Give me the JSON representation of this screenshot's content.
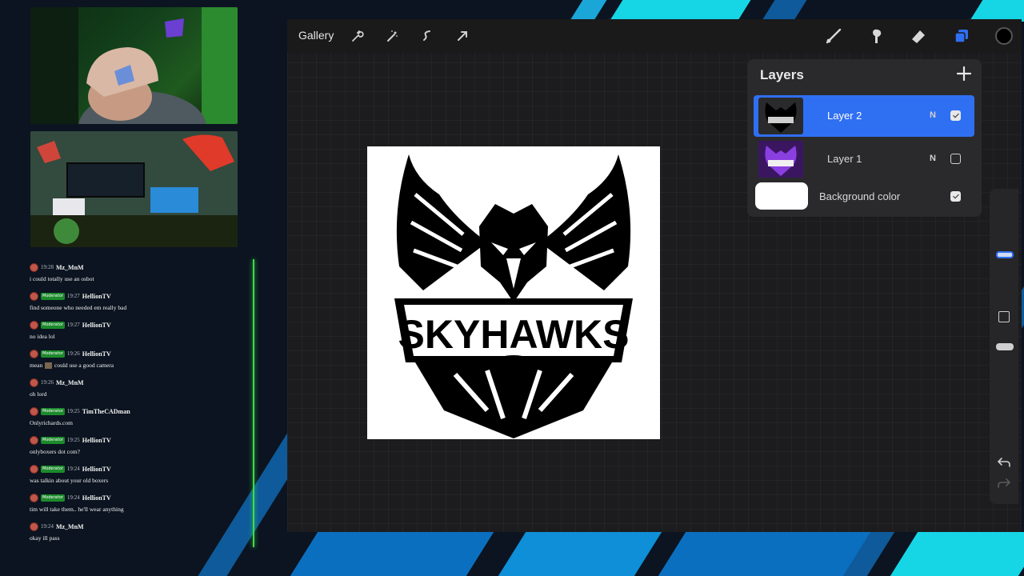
{
  "procreate": {
    "gallery_label": "Gallery",
    "tools_left": [
      "wrench-icon",
      "magic-wand-icon",
      "selection-icon",
      "transform-arrow-icon"
    ],
    "tools_right": [
      "brush-icon",
      "smudge-icon",
      "eraser-icon",
      "layers-icon",
      "color-swatch-icon"
    ],
    "accent_color": "#2f6ff2",
    "active_color": "#000000",
    "artwork_text": "SKYHAWKS",
    "layers_panel": {
      "title": "Layers",
      "layers": [
        {
          "name": "Layer 2",
          "mode": "N",
          "visible": true,
          "active": true
        },
        {
          "name": "Layer 1",
          "mode": "N",
          "visible": false,
          "active": false
        }
      ],
      "background": {
        "name": "Background color",
        "visible": true
      }
    }
  },
  "chat": {
    "accent_color": "#3ddc4a",
    "messages": [
      {
        "time": "19:28",
        "user": "Mz_MnM",
        "moderator": false,
        "text": "i could totally use an osbot"
      },
      {
        "time": "19:27",
        "user": "HellionTV",
        "moderator": true,
        "text": "find someone who needed em really bad"
      },
      {
        "time": "19:27",
        "user": "HellionTV",
        "moderator": true,
        "text": "no idea lol"
      },
      {
        "time": "19:26",
        "user": "HellionTV",
        "moderator": true,
        "text_before": "mean",
        "text_after": "could use a good camera"
      },
      {
        "time": "19:26",
        "user": "Mz_MnM",
        "moderator": false,
        "text": "oh lord"
      },
      {
        "time": "19:25",
        "user": "TimTheCADman",
        "moderator": true,
        "text": "Onlyrichards.com"
      },
      {
        "time": "19:25",
        "user": "HellionTV",
        "moderator": true,
        "text": "onlyboxers dot com?"
      },
      {
        "time": "19:24",
        "user": "HellionTV",
        "moderator": true,
        "text": "was talkin about your old boxers"
      },
      {
        "time": "19:24",
        "user": "HellionTV",
        "moderator": true,
        "text": "tim will take them.. he'll wear anything"
      },
      {
        "time": "19:24",
        "user": "Mz_MnM",
        "moderator": false,
        "text": "okay ill pass"
      }
    ],
    "moderator_badge": "Moderator"
  }
}
